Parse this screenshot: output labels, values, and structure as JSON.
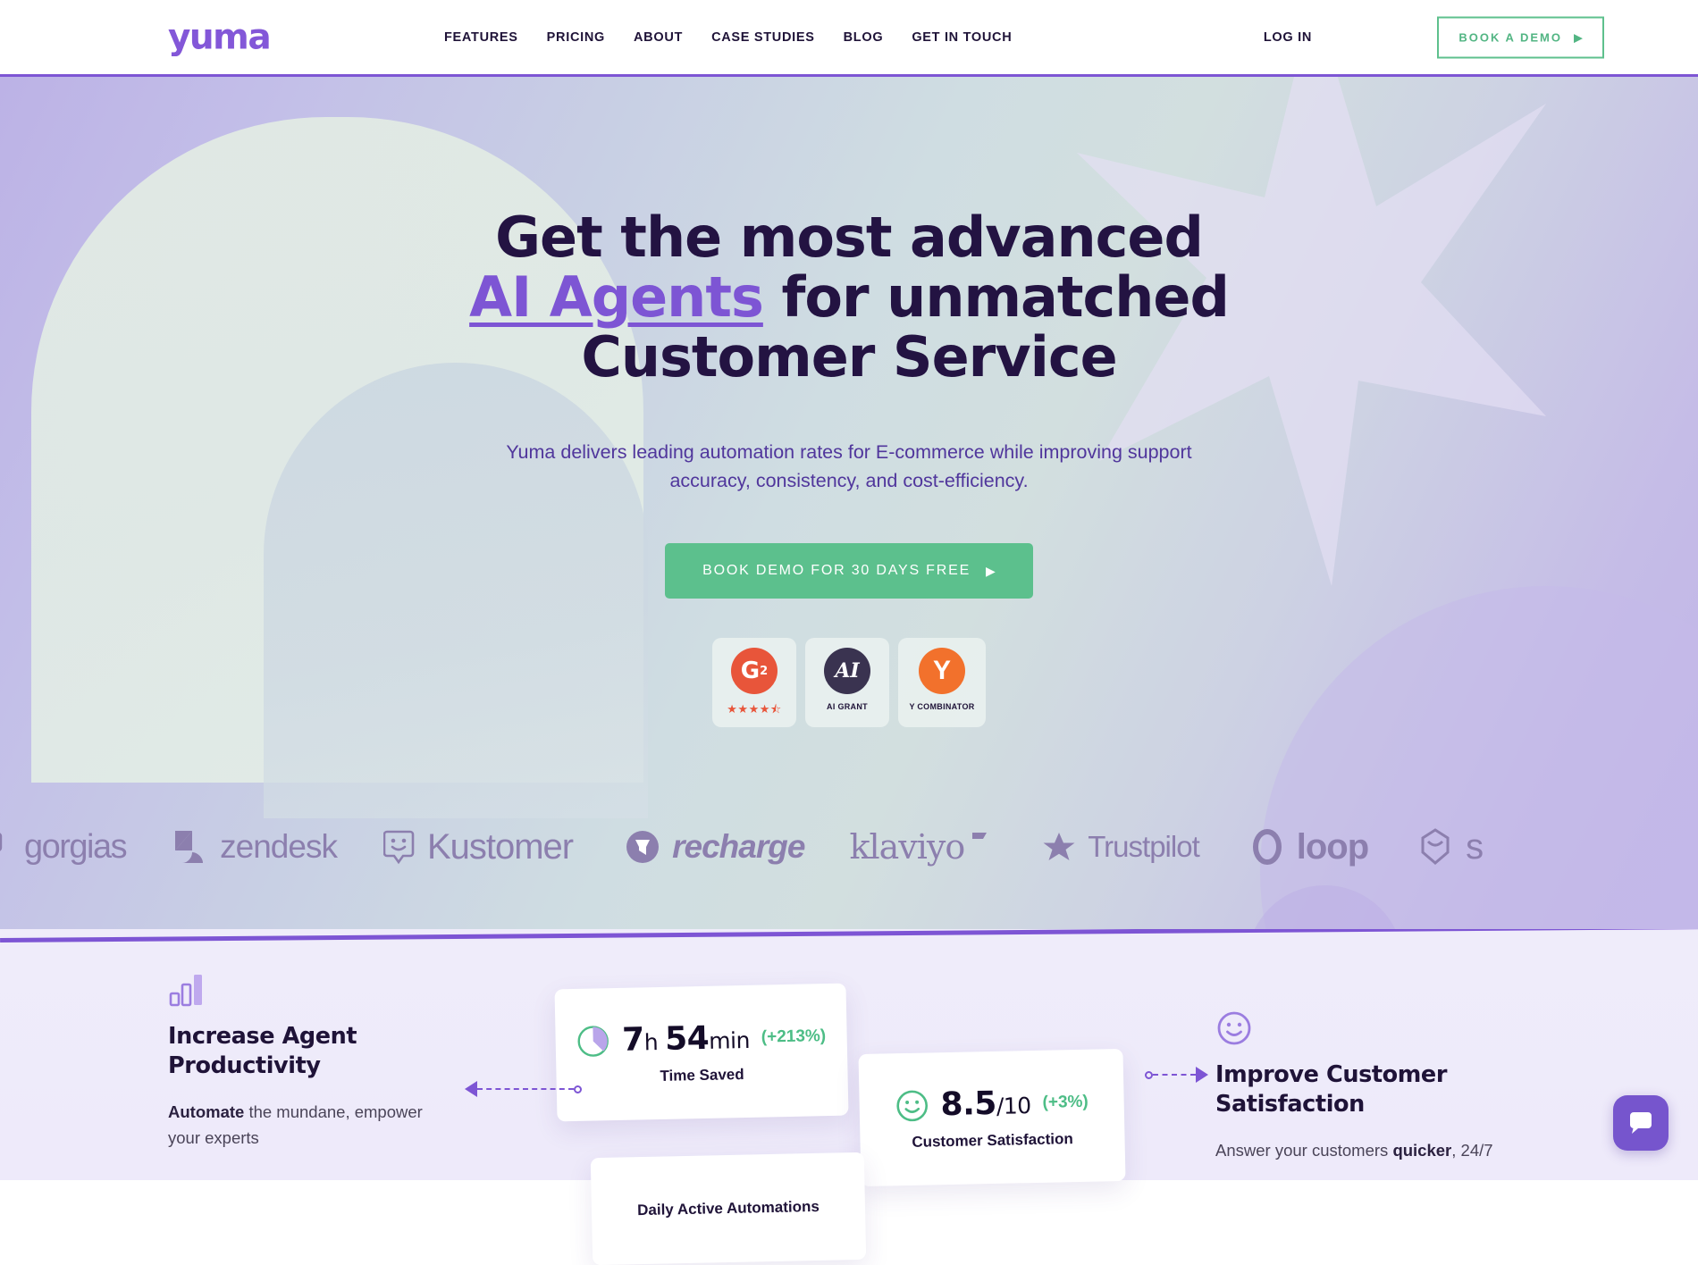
{
  "nav": {
    "logo_text": "yuma",
    "links": [
      {
        "label": "FEATURES"
      },
      {
        "label": "PRICING"
      },
      {
        "label": "ABOUT"
      },
      {
        "label": "CASE STUDIES"
      },
      {
        "label": "BLOG"
      },
      {
        "label": "GET IN TOUCH"
      }
    ],
    "login_label": "LOG IN",
    "demo_label": "BOOK A DEMO",
    "demo_arrow": "▶"
  },
  "hero": {
    "title_line1": "Get the most advanced",
    "title_accent": "AI Agents",
    "title_line2_rest": " for unmatched",
    "title_line3": "Customer Service",
    "subtitle": "Yuma delivers leading automation rates for E-commerce while improving support accuracy, consistency, and cost-efficiency.",
    "cta_label": "BOOK DEMO FOR 30 DAYS FREE",
    "cta_arrow": "▶"
  },
  "badges": [
    {
      "id": "g2",
      "mark": "G",
      "superscript": "2",
      "caption": "",
      "stars": "★★★★⯪",
      "color": "#e8553a"
    },
    {
      "id": "ai-grant",
      "mark": "AI",
      "superscript": "",
      "caption": "AI GRANT",
      "stars": "",
      "color": "#3a3350"
    },
    {
      "id": "y-combinator",
      "mark": "Y",
      "superscript": "",
      "caption": "Y COMBINATOR",
      "stars": "",
      "color": "#f2712c"
    }
  ],
  "partner_logos": [
    {
      "name": "gorgias",
      "icon": "gorgias-icon"
    },
    {
      "name": "zendesk",
      "icon": "zendesk-icon"
    },
    {
      "name": "Kustomer",
      "icon": "kustomer-icon"
    },
    {
      "name": "recharge",
      "icon": "recharge-icon"
    },
    {
      "name": "klaviyo",
      "icon": "klaviyo-icon"
    },
    {
      "name": "Trustpilot",
      "icon": "star-icon"
    },
    {
      "name": "loop",
      "icon": "loop-icon"
    },
    {
      "name": "s",
      "icon": "shopify-icon"
    }
  ],
  "features": {
    "left": {
      "icon": "bar-chart-icon",
      "title_line1": "Increase Agent",
      "title_line2": "Productivity",
      "body_bold": "Automate",
      "body_rest": " the mundane, empower your experts"
    },
    "right": {
      "icon": "smiley-icon",
      "title_line1": "Improve Customer",
      "title_line2": "Satisfaction",
      "body_start": "Answer your customers ",
      "body_bold": "quicker",
      "body_end": ", 24/7"
    }
  },
  "stats": [
    {
      "id": "time-saved",
      "icon": "pie-chart-icon",
      "value_main": "7",
      "value_unit1": "h",
      "value_second": "54",
      "value_unit2": "min",
      "delta": "(+213%)",
      "label": "Time Saved"
    },
    {
      "id": "customer-satisfaction",
      "icon": "smiley-face-icon",
      "value_main": "8.5",
      "value_unit1": "/10",
      "value_second": "",
      "value_unit2": "",
      "delta": "(+3%)",
      "label": "Customer Satisfaction"
    },
    {
      "id": "daily-active-automations",
      "icon": "",
      "value_main": "",
      "value_unit1": "",
      "value_second": "",
      "value_unit2": "",
      "delta": "",
      "label": "Daily Active Automations"
    }
  ],
  "chat": {
    "icon": "chat-bubble-icon"
  },
  "colors": {
    "brand_purple": "#7d55d4",
    "accent_green": "#5cc08d",
    "dark_text": "#1f1338",
    "logo_purple": "#8357d8"
  }
}
